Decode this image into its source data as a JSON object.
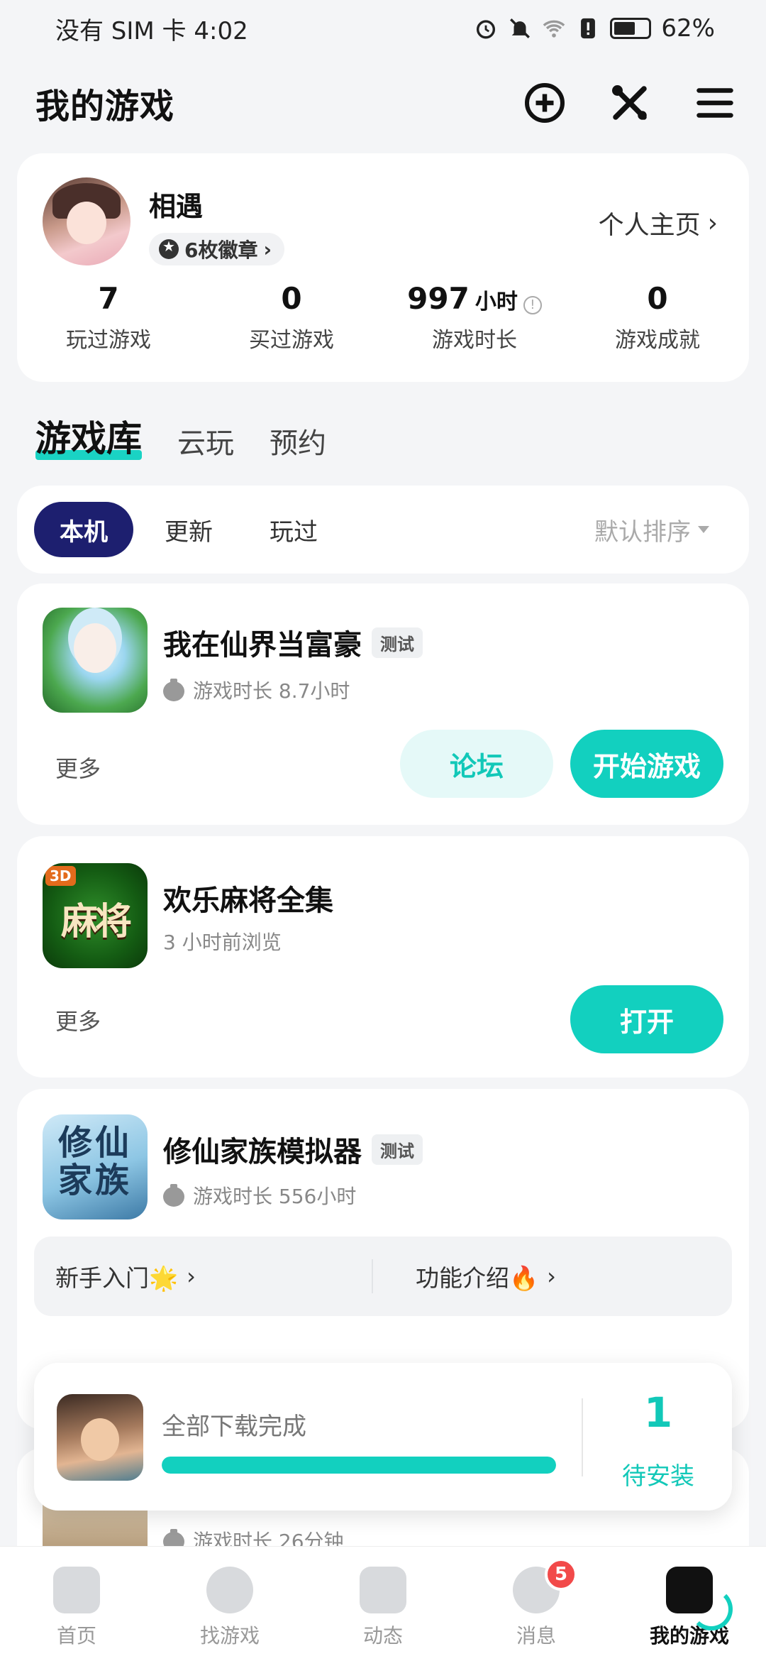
{
  "status_bar": {
    "carrier_time": "没有 SIM 卡 4:02",
    "battery": "62%",
    "icons": [
      "alarm-icon",
      "mute-icon",
      "wifi-icon",
      "sim-alert-icon",
      "battery-icon"
    ]
  },
  "header": {
    "title": "我的游戏",
    "icons": [
      "add-circle-icon",
      "tools-icon",
      "menu-icon"
    ]
  },
  "profile": {
    "name": "相遇",
    "badges": "6枚徽章",
    "homepage_link": "个人主页",
    "stats": [
      {
        "value": "7",
        "unit": "",
        "label": "玩过游戏"
      },
      {
        "value": "0",
        "unit": "",
        "label": "买过游戏"
      },
      {
        "value": "997",
        "unit": "小时",
        "label": "游戏时长"
      },
      {
        "value": "0",
        "unit": "",
        "label": "游戏成就"
      }
    ]
  },
  "library_tabs": [
    {
      "label": "游戏库",
      "active": true
    },
    {
      "label": "云玩",
      "active": false
    },
    {
      "label": "预约",
      "active": false
    }
  ],
  "filters": {
    "chips": [
      {
        "label": "本机",
        "active": true
      },
      {
        "label": "更新",
        "active": false
      },
      {
        "label": "玩过",
        "active": false
      }
    ],
    "sort_label": "默认排序"
  },
  "games": [
    {
      "title": "我在仙界当富豪",
      "tag": "测试",
      "sub": "游戏时长 8.7小时",
      "more": "更多",
      "forum": "论坛",
      "action": "开始游戏"
    },
    {
      "title": "欢乐麻将全集",
      "icon_text": "麻将",
      "icon_badge": "3D",
      "sub": "3 小时前浏览",
      "more": "更多",
      "action": "打开"
    },
    {
      "title": "修仙家族模拟器",
      "tag": "测试",
      "icon_text": "修仙家族",
      "sub": "游戏时长 556小时",
      "quick_links": [
        "新手入门🌟",
        "功能介绍🔥"
      ]
    },
    {
      "sub": "游戏时长 26分钟"
    }
  ],
  "download": {
    "status": "全部下载完成",
    "progress": 1.0,
    "count": "1",
    "count_label": "待安装"
  },
  "nav": [
    {
      "label": "首页",
      "icon": "home-icon"
    },
    {
      "label": "找游戏",
      "icon": "planet-icon"
    },
    {
      "label": "动态",
      "icon": "feed-icon"
    },
    {
      "label": "消息",
      "icon": "message-icon",
      "badge": "5"
    },
    {
      "label": "我的游戏",
      "icon": "gamepad-icon",
      "active": true
    }
  ],
  "colors": {
    "accent": "#12d0bf",
    "chip_active": "#1d1f6f",
    "badge": "#f24a4a"
  }
}
